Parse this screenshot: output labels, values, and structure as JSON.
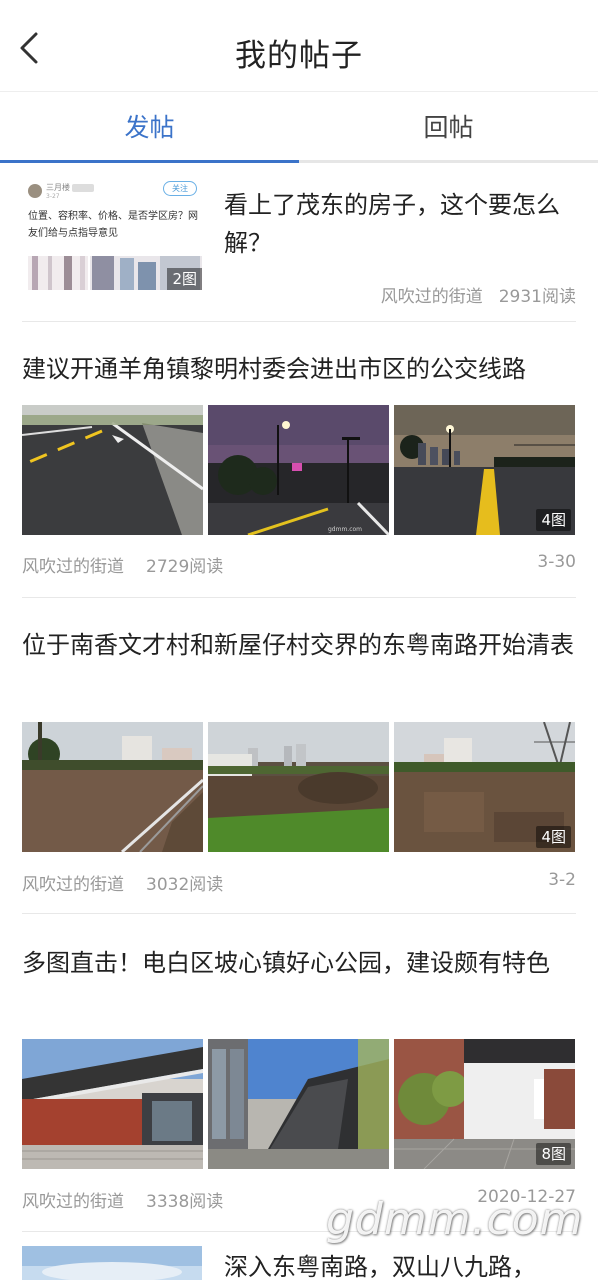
{
  "header": {
    "title": "我的帖子",
    "back_icon": "chevron-left-icon"
  },
  "tabs": [
    {
      "label": "发帖",
      "active": true
    },
    {
      "label": "回帖",
      "active": false
    }
  ],
  "colors": {
    "accent": "#3b73c9",
    "meta": "#999999",
    "divider": "#e8e8e8"
  },
  "posts": [
    {
      "title": "看上了茂东的房子，这个要怎么解？",
      "author": "风吹过的街道",
      "reads": "2931阅读",
      "image_count": "2图",
      "thumb": {
        "user": "三月楼",
        "sub": "3-27",
        "follow": "关注",
        "text": "位置、容积率、价格、是否学区房？网友们给与点指导意见"
      }
    },
    {
      "title": "建议开通羊角镇黎明村委会进出市区的公交线路",
      "author": "风吹过的街道",
      "reads": "2729阅读",
      "date": "3-30",
      "image_count": "4图",
      "image_watermark": "gdmm.com"
    },
    {
      "title": "位于南香文才村和新屋仔村交界的东粤南路开始清表",
      "author": "风吹过的街道",
      "reads": "3032阅读",
      "date": "3-2",
      "image_count": "4图"
    },
    {
      "title": "多图直击！电白区坡心镇好心公园，建设颇有特色",
      "author": "风吹过的街道",
      "reads": "3338阅读",
      "date": "2020-12-27",
      "image_count": "8图"
    },
    {
      "title": "深入东粤南路，双山八九路，"
    }
  ],
  "watermark": "gdmm.com"
}
